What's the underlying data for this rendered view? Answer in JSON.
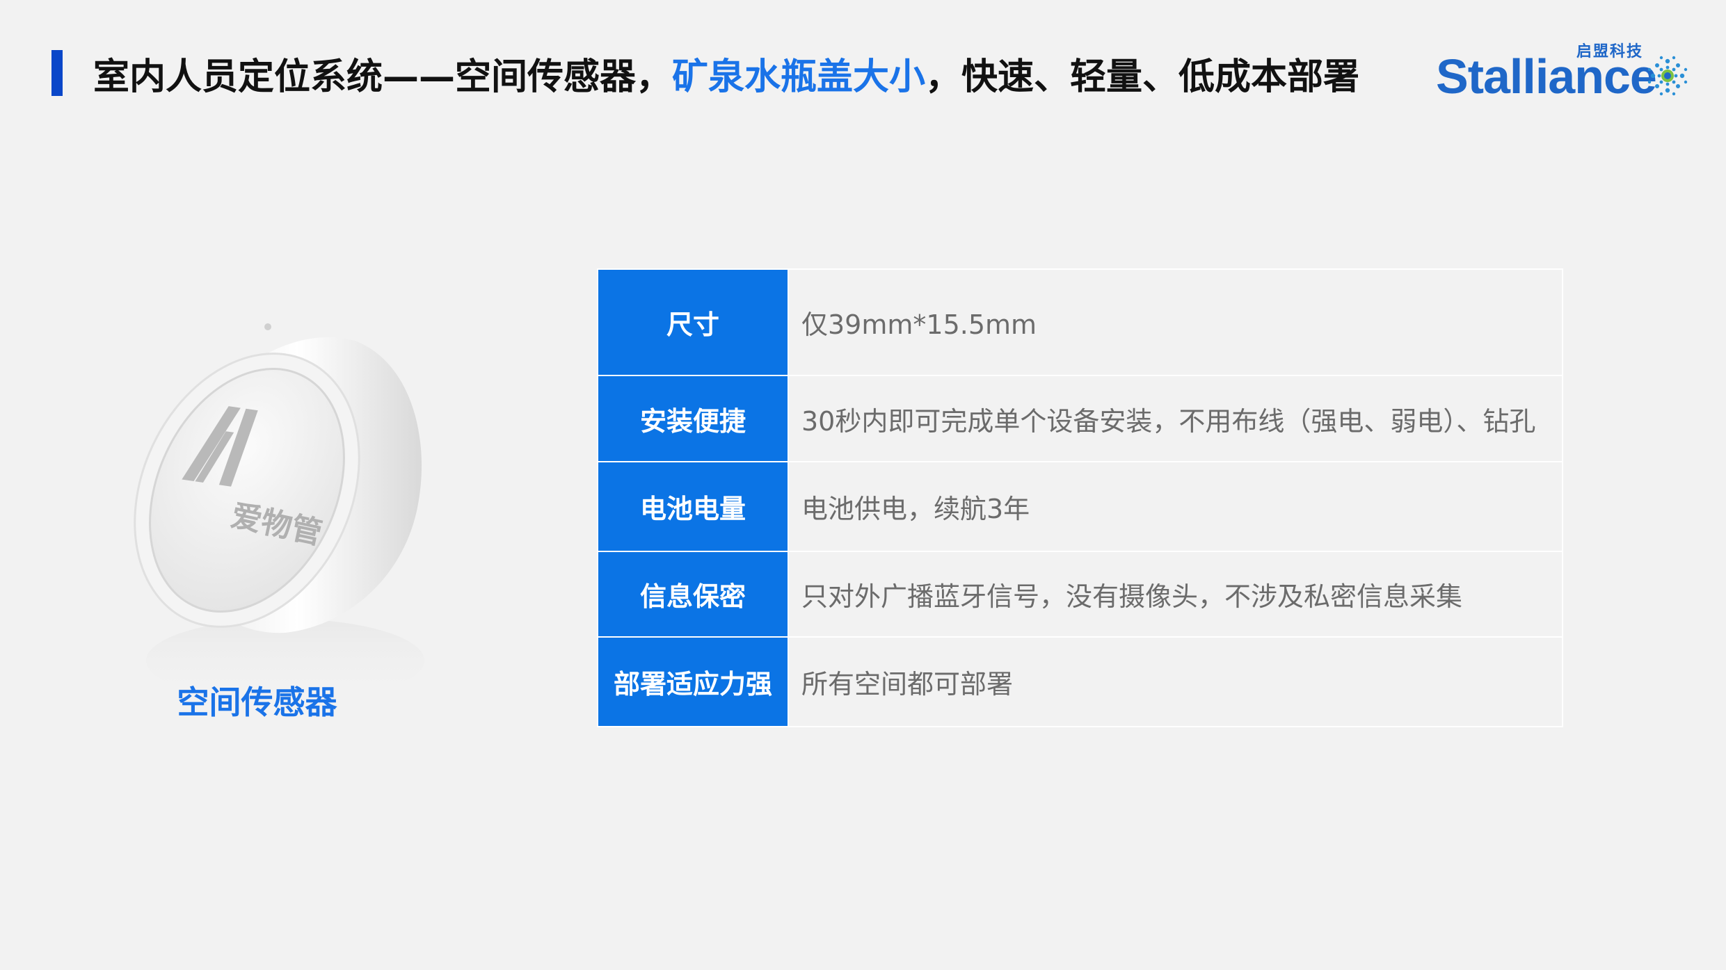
{
  "header": {
    "title_part1": "室内人员定位系统——空间传感器，",
    "title_highlight": "矿泉水瓶盖大小",
    "title_part2": "，快速、轻量、低成本部署",
    "accent_color": "#0a47c9",
    "highlight_color": "#1a73e8"
  },
  "logo": {
    "text": "Stalliance",
    "cn_text": "启盟科技",
    "icon": "network-globe-icon",
    "color": "#1f67c8"
  },
  "product": {
    "caption": "空间传感器",
    "device_text": "爱物管",
    "device_logo": "AI"
  },
  "specs": [
    {
      "label": "尺寸",
      "value": "仅39mm*15.5mm"
    },
    {
      "label": "安装便捷",
      "value": "30秒内即可完成单个设备安装，不用布线（强电、弱电）、钻孔"
    },
    {
      "label": "电池电量",
      "value": "电池供电，续航3年"
    },
    {
      "label": "信息保密",
      "value": "只对外广播蓝牙信号，没有摄像头，不涉及私密信息采集"
    },
    {
      "label": "部署适应力强",
      "value": "所有空间都可部署"
    }
  ],
  "colors": {
    "label_bg": "#0b74e5",
    "background": "#f2f2f2"
  }
}
